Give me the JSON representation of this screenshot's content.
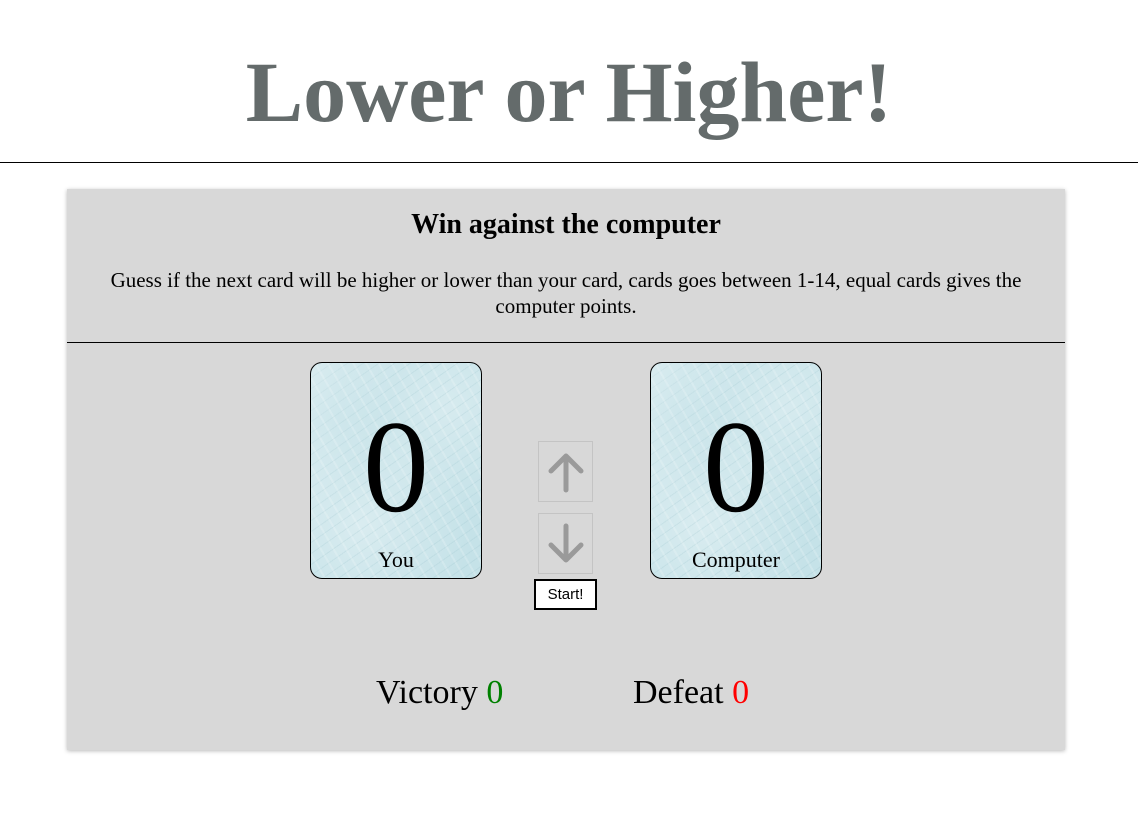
{
  "header": {
    "title": "Lower or Higher!"
  },
  "intro": {
    "heading": "Win against the computer",
    "description": "Guess if the next card will be higher or lower than your card, cards goes between 1-14, equal cards gives the computer points."
  },
  "cards": {
    "player": {
      "value": "0",
      "label": "You"
    },
    "computer": {
      "value": "0",
      "label": "Computer"
    }
  },
  "controls": {
    "higher_icon": "arrow-up-icon",
    "lower_icon": "arrow-down-icon",
    "start_label": "Start!"
  },
  "score": {
    "victory_label": "Victory",
    "victory_value": "0",
    "defeat_label": "Defeat",
    "defeat_value": "0"
  },
  "colors": {
    "title": "#646b6b",
    "panel_background": "#d8d8d8",
    "card_background": "#c5e2e8",
    "victory_value": "#008000",
    "defeat_value": "#ff0000",
    "arrow_icon": "#9a9a9a"
  }
}
